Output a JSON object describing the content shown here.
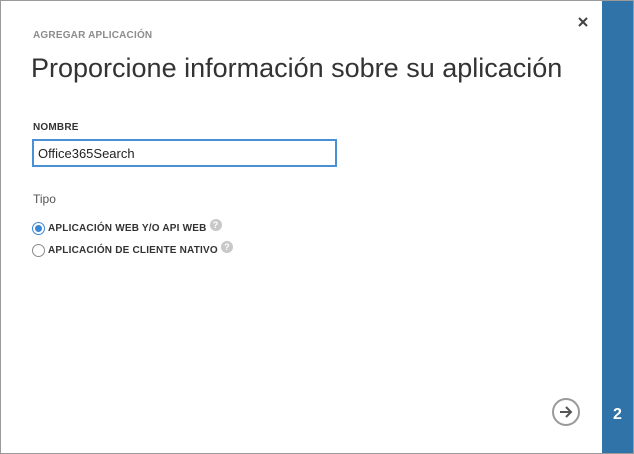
{
  "dialog": {
    "subtitle": "AGREGAR APLICACIÓN",
    "title": "Proporcione información sobre su aplicación",
    "close_icon": "close-icon",
    "step": "2"
  },
  "form": {
    "name_label": "NOMBRE",
    "name_value": "Office365Search",
    "type_label": "Tipo",
    "options": [
      {
        "label": "APLICACIÓN WEB Y/O API WEB",
        "selected": true,
        "help_icon": "question-mark-icon"
      },
      {
        "label": "APLICACIÓN DE CLIENTE NATIVO",
        "selected": false,
        "help_icon": "question-mark-icon"
      }
    ]
  },
  "navigation": {
    "next_icon": "arrow-right-circle-icon"
  },
  "colors": {
    "accent": "#2f73a8",
    "input_border": "#4a90d6"
  }
}
